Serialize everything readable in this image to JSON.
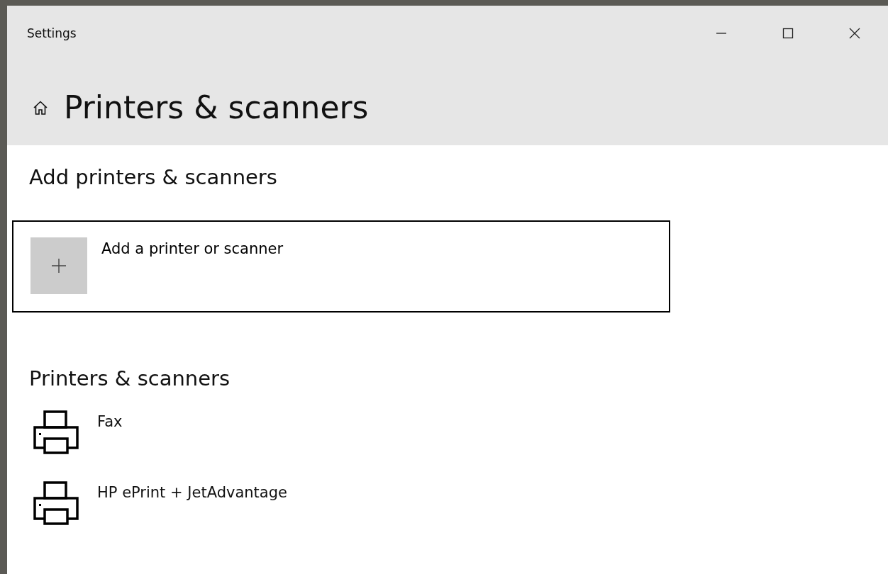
{
  "window": {
    "title": "Settings"
  },
  "page": {
    "title": "Printers & scanners"
  },
  "add_section": {
    "heading": "Add printers & scanners",
    "button": {
      "label": "Add a printer or scanner",
      "focused": true
    }
  },
  "devices_section": {
    "heading": "Printers & scanners",
    "items": [
      {
        "name": "Fax"
      },
      {
        "name": "HP ePrint + JetAdvantage"
      }
    ]
  }
}
